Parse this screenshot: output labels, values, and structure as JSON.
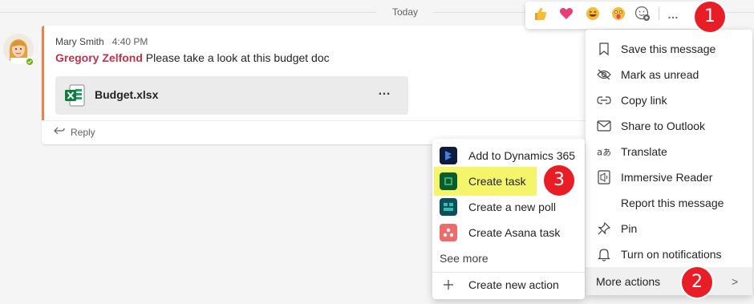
{
  "divider": {
    "label": "Today"
  },
  "message": {
    "author": "Mary Smith",
    "time": "4:40 PM",
    "mention": "Gregory Zelfond",
    "text": "Please take a look at this budget doc",
    "file_name": "Budget.xlsx",
    "file_more": "…",
    "reply_label": "Reply"
  },
  "reactions": {
    "items": [
      "like-icon",
      "heart-icon",
      "laugh-icon",
      "surprised-icon",
      "add-reaction-icon"
    ],
    "more_label": "…"
  },
  "badges": [
    "1",
    "2",
    "3"
  ],
  "menu": {
    "items": [
      {
        "icon": "bookmark-icon",
        "label": "Save this message"
      },
      {
        "icon": "unread-icon",
        "label": "Mark as unread"
      },
      {
        "icon": "link-icon",
        "label": "Copy link"
      },
      {
        "icon": "mail-icon",
        "label": "Share to Outlook"
      },
      {
        "icon": "translate-icon",
        "label": "Translate"
      },
      {
        "icon": "immersive-reader-icon",
        "label": "Immersive Reader"
      },
      {
        "icon": "",
        "label": "Report this message"
      },
      {
        "icon": "pin-icon",
        "label": "Pin"
      },
      {
        "icon": "bell-icon",
        "label": "Turn on notifications"
      },
      {
        "icon": "",
        "label": "More actions",
        "chevron": ">"
      }
    ]
  },
  "submenu": {
    "items": [
      {
        "icon": "dynamics-365-icon",
        "label": "Add to Dynamics 365"
      },
      {
        "icon": "planner-icon",
        "label": "Create task"
      },
      {
        "icon": "forms-poll-icon",
        "label": "Create a new poll"
      },
      {
        "icon": "asana-icon",
        "label": "Create Asana task"
      }
    ],
    "see_more": "See more",
    "create_new_action": "Create new action"
  },
  "colors": {
    "accent_orange": "#e8834e",
    "mention_red": "#c4314b",
    "badge_red": "#e81d26",
    "highlight_yellow": "#f4f56a",
    "teams_purple": "#5b5fc7"
  }
}
